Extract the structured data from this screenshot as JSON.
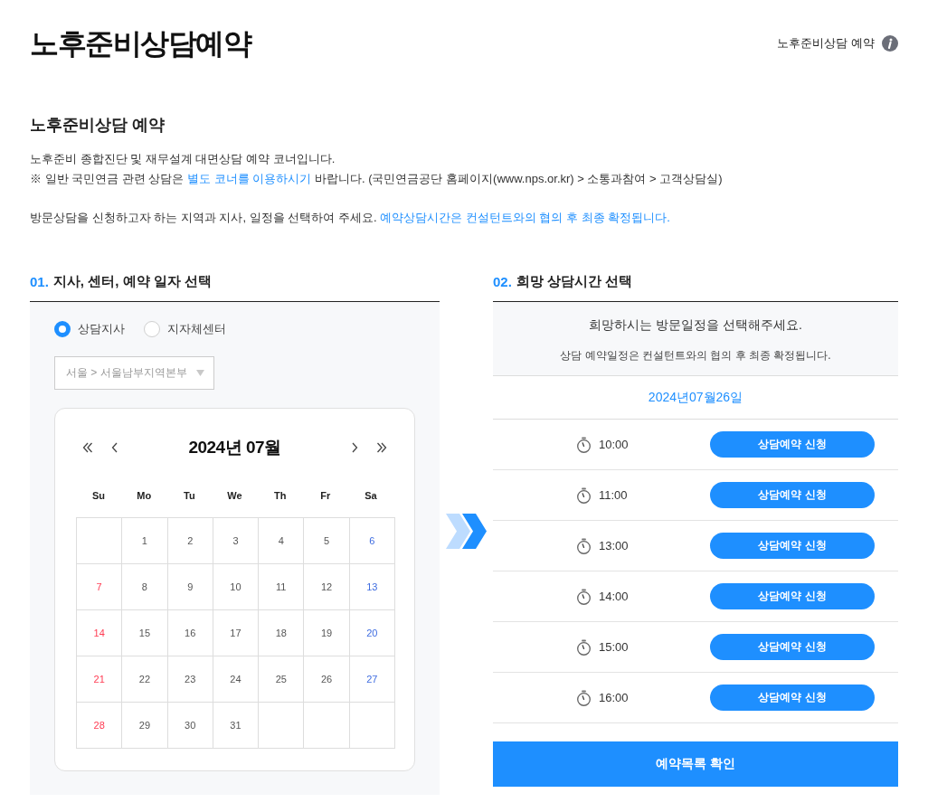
{
  "page_title": "노후준비상담예약",
  "breadcrumb": {
    "label": "노후준비상담 예약"
  },
  "intro": {
    "heading": "노후준비상담 예약",
    "line_1": "노후준비 종합진단 및 재무설계 대면상담 예약 코너입니다.",
    "line_2": {
      "before": "※ 일반 국민연금 관련 상담은",
      "link": "별도 코너를 이용하시기",
      "after": "바랍니다. (국민연금공단 홈페이지(www.nps.or.kr) > 소통과참여 > 고객상담실)"
    },
    "line_3": "방문상담을 신청하고자 하는 지역과 지사, 일정을 선택하여 주세요.",
    "line_3_notice": "예약상담시간은 컨설턴트와의 협의 후 최종 확정됩니다."
  },
  "step_1": {
    "number": "01.",
    "title": "지사, 센터, 예약 일자 선택",
    "options": [
      {
        "label": "상담지사",
        "selected": true
      },
      {
        "label": "지자체센터",
        "selected": false
      }
    ],
    "branch_select": {
      "value": "서울 > 서울남부지역본부"
    },
    "calendar": {
      "title": "2024년 07월",
      "weekdays": [
        "Su",
        "Mo",
        "Tu",
        "We",
        "Th",
        "Fr",
        "Sa"
      ],
      "weeks": [
        {
          "kind": "first",
          "days": [
            "1",
            "2",
            "3",
            "4",
            "5",
            "6"
          ]
        },
        {
          "kind": "full",
          "days": [
            "7",
            "8",
            "9",
            "10",
            "11",
            "12",
            "13"
          ]
        },
        {
          "kind": "full",
          "days": [
            "14",
            "15",
            "16",
            "17",
            "18",
            "19",
            "20"
          ]
        },
        {
          "kind": "full",
          "days": [
            "21",
            "22",
            "23",
            "24",
            "25",
            "26",
            "27"
          ]
        },
        {
          "kind": "last",
          "days": [
            "28",
            "29",
            "30",
            "31"
          ]
        }
      ]
    }
  },
  "step_2": {
    "number": "02.",
    "title": "희망 상담시간 선택",
    "prompt": "희망하시는 방문일정을 선택해주세요.",
    "note": "상담 예약일정은 컨설턴트와의 협의 후 최종 확정됩니다.",
    "date": "2024년07월26일",
    "slots": [
      {
        "time": "10:00",
        "button": "상담예약 신청"
      },
      {
        "time": "11:00",
        "button": "상담예약 신청"
      },
      {
        "time": "13:00",
        "button": "상담예약 신청"
      },
      {
        "time": "14:00",
        "button": "상담예약 신청"
      },
      {
        "time": "15:00",
        "button": "상담예약 신청"
      },
      {
        "time": "16:00",
        "button": "상담예약 신청"
      }
    ],
    "list_button": "예약목록 확인"
  }
}
